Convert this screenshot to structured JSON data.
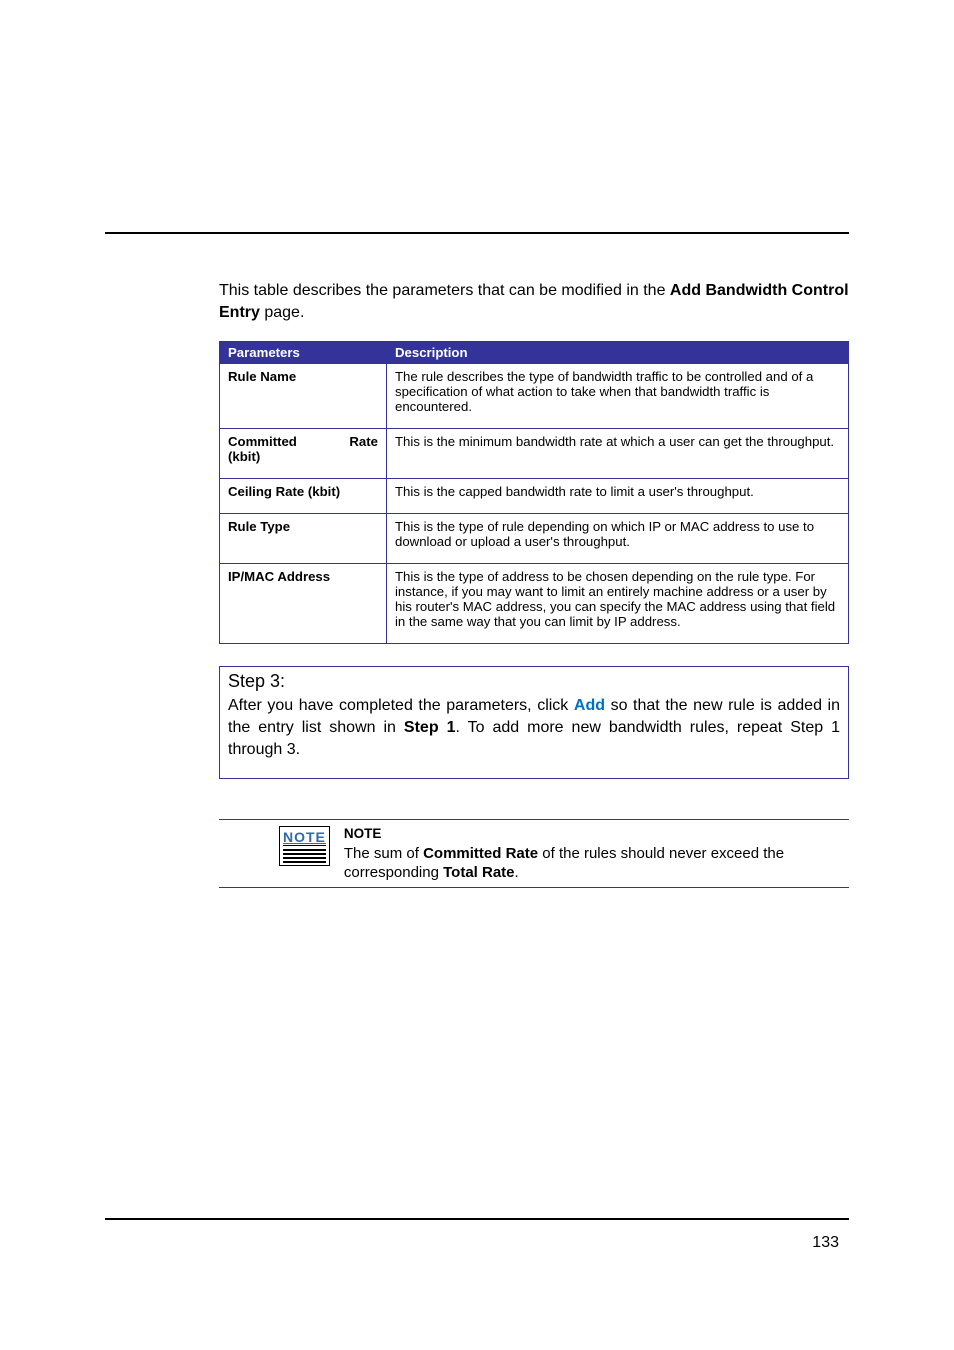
{
  "intro": {
    "pre": "This table describes the parameters that can be modified in the ",
    "bold": "Add Bandwidth Control Entry",
    "post": " page."
  },
  "table": {
    "headers": {
      "param": "Parameters",
      "desc": "Description"
    },
    "rows": [
      {
        "name": "Rule Name",
        "desc": "The rule describes the type of bandwidth traffic to be controlled and of a specification of what action to take when that bandwidth traffic is encountered."
      },
      {
        "name": "Committed Rate (kbit)",
        "desc": "This is the minimum bandwidth rate at which a user can get the throughput."
      },
      {
        "name": "Ceiling Rate (kbit)",
        "desc": "This is the capped bandwidth rate to limit a user's throughput."
      },
      {
        "name": "Rule Type",
        "desc": "This is the type of rule depending on which IP or MAC address to use to download or upload a user's throughput."
      },
      {
        "name": "IP/MAC Address",
        "desc": "This is the type of address to be chosen depending on the rule type. For instance, if you may want to limit an entirely machine address or a user by his router's MAC address, you can specify the MAC address using that field in the same way that you can limit by IP address."
      }
    ]
  },
  "step": {
    "title": "Step 3:",
    "p1a": "After you have completed the parameters, click ",
    "add": "Add",
    "p1b": " so that the new rule is added in the entry list shown in ",
    "step1": "Step 1",
    "p1c": ".  To add more new bandwidth rules, repeat Step 1 through 3."
  },
  "note": {
    "icon_label": "NOTE",
    "head": "NOTE",
    "t1": "The sum of ",
    "b1": "Committed Rate",
    "t2": " of the rules should never exceed the corresponding ",
    "b2": "Total Rate",
    "t3": "."
  },
  "page_number": "133"
}
